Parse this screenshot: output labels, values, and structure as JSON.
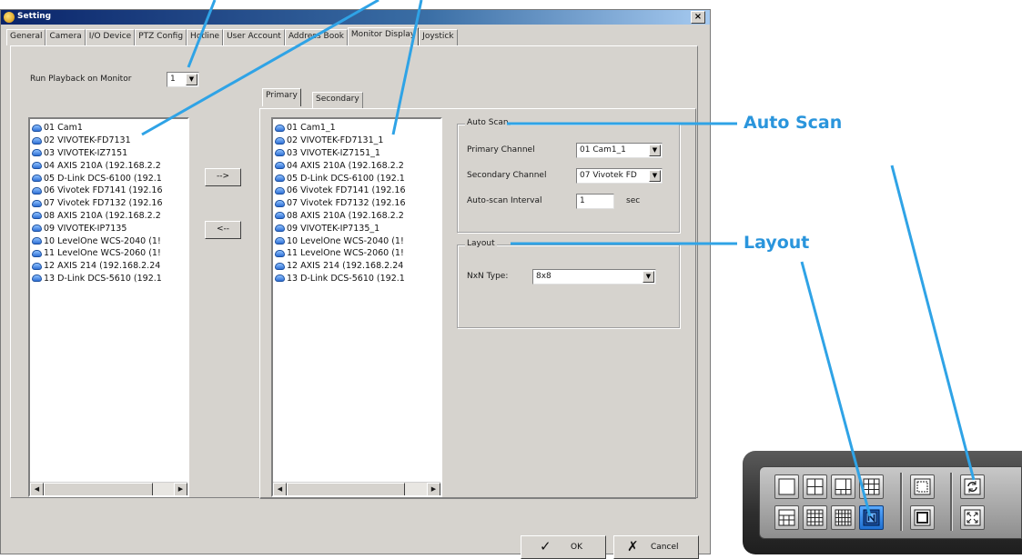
{
  "window": {
    "title": "Setting"
  },
  "tabs": [
    "General",
    "Camera",
    "I/O Device",
    "PTZ Config",
    "Hotline",
    "User Account",
    "Address Book",
    "Monitor Display",
    "Joystick"
  ],
  "run_playback": {
    "label": "Run Playback on Monitor",
    "value": "1"
  },
  "source_list": {
    "items": [
      "01 Cam1",
      "02 VIVOTEK-FD7131",
      "03 VIVOTEK-IZ7151",
      "04 AXIS 210A (192.168.2.2",
      "05 D-Link DCS-6100 (192.1",
      "06 Vivotek FD7141 (192.16",
      "07 Vivotek FD7132 (192.16",
      "08 AXIS 210A (192.168.2.2",
      "09 VIVOTEK-IP7135",
      "10 LevelOne WCS-2040 (1!",
      "11 LevelOne WCS-2060 (1!",
      "12 AXIS 214 (192.168.2.24",
      "13 D-Link DCS-5610 (192.1"
    ]
  },
  "move_buttons": {
    "add": "-->",
    "remove": "<--"
  },
  "sub_tabs": [
    "Primary",
    "Secondary"
  ],
  "monitor_list": {
    "items": [
      "01 Cam1_1",
      "02 VIVOTEK-FD7131_1",
      "03 VIVOTEK-IZ7151_1",
      "04 AXIS 210A (192.168.2.2",
      "05 D-Link DCS-6100 (192.1",
      "06 Vivotek FD7141 (192.16",
      "07 Vivotek FD7132 (192.16",
      "08 AXIS 210A (192.168.2.2",
      "09 VIVOTEK-IP7135_1",
      "10 LevelOne WCS-2040 (1!",
      "11 LevelOne WCS-2060 (1!",
      "12 AXIS 214 (192.168.2.24",
      "13 D-Link DCS-5610 (192.1"
    ]
  },
  "auto_scan": {
    "title": "Auto Scan",
    "primary_label": "Primary Channel",
    "primary_value": "01 Cam1_1",
    "secondary_label": "Secondary Channel",
    "secondary_value": "07 Vivotek FD",
    "interval_label": "Auto-scan Interval",
    "interval_value": "1",
    "interval_unit": "sec"
  },
  "layout": {
    "title": "Layout",
    "nxn_label": "NxN Type:",
    "nxn_value": "8x8"
  },
  "footer": {
    "ok": "OK",
    "cancel": "Cancel"
  },
  "annotations": {
    "auto_scan": "Auto Scan",
    "layout": "Layout"
  },
  "toolbar": {
    "row1": [
      "single-view-icon",
      "quad-view-icon",
      "six-view-icon",
      "nine-view-icon",
      "sequence-icon",
      "auto-scan-icon"
    ],
    "row2": [
      "thirteen-view-icon",
      "sixteen-view-icon",
      "twenty-view-icon",
      "nxn-view-icon",
      "fullscreen-icon",
      "expand-icon"
    ],
    "active": "nxn-view-icon",
    "accent": "#2fa3e6"
  }
}
